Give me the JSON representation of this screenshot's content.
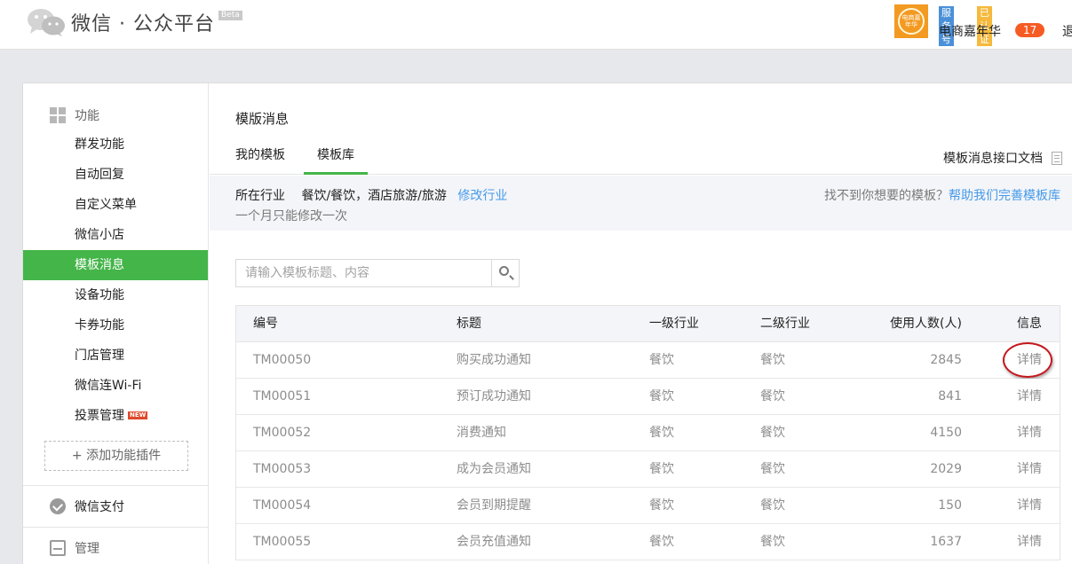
{
  "header": {
    "logo_text": "微信 · 公众平台",
    "beta": "Beta",
    "account": {
      "avatar_text": "电商嘉年华",
      "tag_service": "服务号",
      "tag_verified": "已认证",
      "name": "电商嘉年华",
      "badge_count": "17",
      "logout": "退"
    }
  },
  "sidebar": {
    "function_group": "功能",
    "items": [
      {
        "label": "群发功能"
      },
      {
        "label": "自动回复"
      },
      {
        "label": "自定义菜单"
      },
      {
        "label": "微信小店"
      },
      {
        "label": "模板消息"
      },
      {
        "label": "设备功能"
      },
      {
        "label": "卡券功能"
      },
      {
        "label": "门店管理"
      },
      {
        "label": "微信连Wi-Fi"
      },
      {
        "label": "投票管理",
        "tag": "NEW"
      }
    ],
    "add_plugin": "+ 添加功能插件",
    "payment_group": "微信支付",
    "manage_group": "管理"
  },
  "main": {
    "title": "模版消息",
    "tabs": [
      {
        "label": "我的模板",
        "active": false
      },
      {
        "label": "模板库",
        "active": true
      }
    ],
    "doc_link": "模板消息接口文档",
    "industry": {
      "label": "所在行业",
      "value": "餐饮/餐饮，酒店旅游/旅游",
      "modify_link": "修改行业",
      "note": "一个月只能修改一次",
      "help_text": "找不到你想要的模板？",
      "help_link": "帮助我们完善模板库"
    },
    "search": {
      "placeholder": "请输入模板标题、内容",
      "value": ""
    },
    "table": {
      "headers": [
        "编号",
        "标题",
        "一级行业",
        "二级行业",
        "使用人数(人)",
        "信息"
      ],
      "rows": [
        {
          "code": "TM00050",
          "title": "购买成功通知",
          "ind1": "餐饮",
          "ind2": "餐饮",
          "users": "2845",
          "info": "详情"
        },
        {
          "code": "TM00051",
          "title": "预订成功通知",
          "ind1": "餐饮",
          "ind2": "餐饮",
          "users": "841",
          "info": "详情"
        },
        {
          "code": "TM00052",
          "title": "消费通知",
          "ind1": "餐饮",
          "ind2": "餐饮",
          "users": "4150",
          "info": "详情"
        },
        {
          "code": "TM00053",
          "title": "成为会员通知",
          "ind1": "餐饮",
          "ind2": "餐饮",
          "users": "2029",
          "info": "详情"
        },
        {
          "code": "TM00054",
          "title": "会员到期提醒",
          "ind1": "餐饮",
          "ind2": "餐饮",
          "users": "150",
          "info": "详情"
        },
        {
          "code": "TM00055",
          "title": "会员充值通知",
          "ind1": "餐饮",
          "ind2": "餐饮",
          "users": "1637",
          "info": "详情"
        }
      ]
    }
  },
  "colors": {
    "accent": "#44b549",
    "link": "#459ae9",
    "highlight_ring": "#c4161c"
  }
}
